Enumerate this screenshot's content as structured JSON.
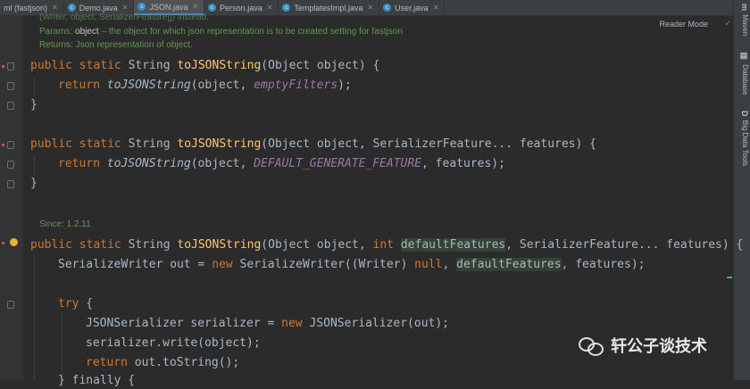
{
  "tabs": [
    {
      "label": "ml (fastjson)",
      "icon": "",
      "active": false
    },
    {
      "label": "Demo.java",
      "icon": "c",
      "active": false
    },
    {
      "label": "JSON.java",
      "icon": "c",
      "active": true
    },
    {
      "label": "Person.java",
      "icon": "c",
      "active": false
    },
    {
      "label": "TemplatesImpl.java",
      "icon": "c",
      "active": false
    },
    {
      "label": "User.java",
      "icon": "c",
      "active": false
    }
  ],
  "right_tools": {
    "maven": "Maven",
    "maven_icon": "m",
    "database": "Database",
    "database_icon": "db-icon",
    "bigdata": "Big Data Tools",
    "bigdata_icon": "D"
  },
  "reader_mode": "Reader Mode",
  "doc1": {
    "cut_line": "(Writer, object, SerializerFeature[]) instead.",
    "params_label": "Params:",
    "params_name": "object",
    "params_desc": "– the object for which json representation is to be created setting for fastjson",
    "returns": "Returns: Json representation of object."
  },
  "doc2": {
    "since": "Since: 1.2.11"
  },
  "code": {
    "l1": {
      "kw": "public static ",
      "type": "String ",
      "fn": "toJSONString",
      "rest": "(Object object) {"
    },
    "l2": {
      "kw": "return ",
      "call": "toJSONString",
      "open": "(object, ",
      "arg": "emptyFilters",
      "close": ");"
    },
    "l3": "}",
    "l4": {
      "kw": "public static ",
      "type": "String ",
      "fn": "toJSONString",
      "rest": "(Object object, SerializerFeature... features) {"
    },
    "l5": {
      "kw": "return ",
      "call": "toJSONString",
      "open": "(object, ",
      "arg": "DEFAULT_GENERATE_FEATURE",
      "close": ", features);"
    },
    "l6": "}",
    "l7": {
      "kw": "public static ",
      "type": "String ",
      "fn": "toJSONString",
      "p1": "(Object object, ",
      "kw2": "int ",
      "hl": "defaultFeatures",
      "p2": ", SerializerFeature... features) {"
    },
    "l8": {
      "a": "SerializeWriter out = ",
      "kw": "new ",
      "b": "SerializeWriter((Writer) ",
      "kw2": "null",
      "c": ", ",
      "hl": "defaultFeatures",
      "d": ", features);"
    },
    "l9": {
      "kw": "try",
      "rest": " {"
    },
    "l10": {
      "a": "JSONSerializer serializer = ",
      "kw": "new ",
      "b": "JSONSerializer(out);"
    },
    "l11": "serializer.write(object);",
    "l12": {
      "kw": "return ",
      "rest": "out.toString();"
    },
    "l13": "} finally {"
  },
  "watermark": "轩公子谈技术"
}
